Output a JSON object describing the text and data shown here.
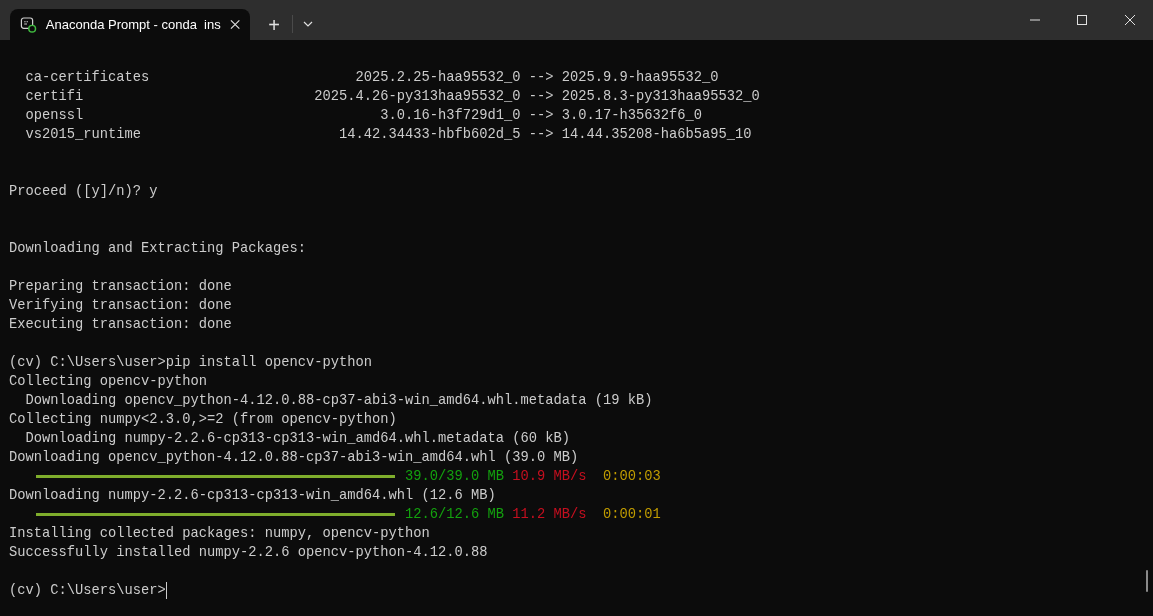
{
  "window": {
    "tab_title": "Anaconda Prompt - conda  ins",
    "new_tab": "+"
  },
  "lines": [
    {
      "kind": "package",
      "name": "ca-certificates",
      "from": "2025.2.25-haa95532_0",
      "arrow": "-->",
      "to": "2025.9.9-haa95532_0"
    },
    {
      "kind": "package",
      "name": "certifi",
      "from": "2025.4.26-py313haa95532_0",
      "arrow": "-->",
      "to": "2025.8.3-py313haa95532_0"
    },
    {
      "kind": "package",
      "name": "openssl",
      "from": "3.0.16-h3f729d1_0",
      "arrow": "-->",
      "to": "3.0.17-h35632f6_0"
    },
    {
      "kind": "package",
      "name": "vs2015_runtime",
      "from": "14.42.34433-hbfb602d_5",
      "arrow": "-->",
      "to": "14.44.35208-ha6b5a95_10"
    },
    {
      "kind": "blank"
    },
    {
      "kind": "blank"
    },
    {
      "kind": "text",
      "text": "Proceed ([y]/n)? y"
    },
    {
      "kind": "blank"
    },
    {
      "kind": "blank"
    },
    {
      "kind": "text",
      "text": "Downloading and Extracting Packages:"
    },
    {
      "kind": "blank"
    },
    {
      "kind": "text",
      "text": "Preparing transaction: done"
    },
    {
      "kind": "text",
      "text": "Verifying transaction: done"
    },
    {
      "kind": "text",
      "text": "Executing transaction: done"
    },
    {
      "kind": "blank"
    },
    {
      "kind": "text",
      "text": "(cv) C:\\Users\\user>pip install opencv-python"
    },
    {
      "kind": "text",
      "text": "Collecting opencv-python"
    },
    {
      "kind": "text",
      "text": "Downloading opencv_python-4.12.0.88-cp37-abi3-win_amd64.whl.metadata (19 kB)",
      "indent": true
    },
    {
      "kind": "text",
      "text": "Collecting numpy<2.3.0,>=2 (from opencv-python)"
    },
    {
      "kind": "text",
      "text": "Downloading numpy-2.2.6-cp313-cp313-win_amd64.whl.metadata (60 kB)",
      "indent": true
    },
    {
      "kind": "text",
      "text": "Downloading opencv_python-4.12.0.88-cp37-abi3-win_amd64.whl (39.0 MB)"
    },
    {
      "kind": "progress",
      "level": 1,
      "size": "39.0/39.0 MB",
      "speed": "10.9 MB/s",
      "eta": "0:00:03"
    },
    {
      "kind": "text",
      "text": "Downloading numpy-2.2.6-cp313-cp313-win_amd64.whl (12.6 MB)"
    },
    {
      "kind": "progress",
      "level": 1,
      "size": "12.6/12.6 MB",
      "speed": "11.2 MB/s",
      "eta": "0:00:01"
    },
    {
      "kind": "text",
      "text": "Installing collected packages: numpy, opencv-python"
    },
    {
      "kind": "text",
      "text": "Successfully installed numpy-2.2.6 opencv-python-4.12.0.88"
    },
    {
      "kind": "blank"
    },
    {
      "kind": "prompt",
      "text": "(cv) C:\\Users\\user>"
    }
  ]
}
